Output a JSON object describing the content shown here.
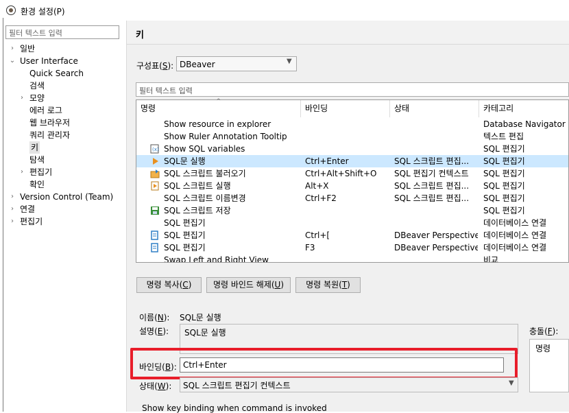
{
  "window": {
    "title": "환경 설정(P)"
  },
  "left": {
    "filter_placeholder": "필터 텍스트 입력",
    "tree": [
      {
        "label": "일반",
        "indent": 0,
        "arrow": "›"
      },
      {
        "label": "User Interface",
        "indent": 0,
        "arrow": "⌄"
      },
      {
        "label": "Quick Search",
        "indent": 1,
        "arrow": ""
      },
      {
        "label": "검색",
        "indent": 1,
        "arrow": ""
      },
      {
        "label": "모양",
        "indent": 1,
        "arrow": "›"
      },
      {
        "label": "에러 로그",
        "indent": 1,
        "arrow": ""
      },
      {
        "label": "웹 브라우저",
        "indent": 1,
        "arrow": ""
      },
      {
        "label": "쿼리 관리자",
        "indent": 1,
        "arrow": ""
      },
      {
        "label": "키",
        "indent": 1,
        "arrow": "",
        "selected": true
      },
      {
        "label": "탐색",
        "indent": 1,
        "arrow": ""
      },
      {
        "label": "편집기",
        "indent": 1,
        "arrow": "›"
      },
      {
        "label": "확인",
        "indent": 1,
        "arrow": ""
      },
      {
        "label": "Version Control (Team)",
        "indent": 0,
        "arrow": "›"
      },
      {
        "label": "연결",
        "indent": 0,
        "arrow": "›"
      },
      {
        "label": "편집기",
        "indent": 0,
        "arrow": "›"
      }
    ]
  },
  "page": {
    "title": "키"
  },
  "scheme": {
    "label": "구성표",
    "mnemonic": "S",
    "value": "DBeaver"
  },
  "command_filter": {
    "placeholder": "필터 텍스트 입력"
  },
  "table": {
    "columns": [
      "명령",
      "바인딩",
      "상태",
      "카테고리"
    ],
    "rows": [
      {
        "icon": "",
        "name": "Show resource in explorer",
        "binding": "",
        "when": "",
        "category": "Database Navigator"
      },
      {
        "icon": "",
        "name": "Show Ruler Annotation Tooltip",
        "binding": "",
        "when": "",
        "category": "텍스트 편집"
      },
      {
        "icon": "variables-icon",
        "name": "Show SQL variables",
        "binding": "",
        "when": "",
        "category": "SQL 편집기"
      },
      {
        "icon": "execute-arrow-icon",
        "name": "SQL문 실행",
        "binding": "Ctrl+Enter",
        "when": "SQL 스크립트 편집...",
        "category": "SQL 편집기",
        "selected": true
      },
      {
        "icon": "load-script-icon",
        "name": "SQL 스크립트 불러오기",
        "binding": "Ctrl+Alt+Shift+O",
        "when": "SQL 편집기 컨텍스트",
        "category": "SQL 편집기"
      },
      {
        "icon": "run-script-icon",
        "name": "SQL 스크립트 실행",
        "binding": "Alt+X",
        "when": "SQL 스크립트 편집...",
        "category": "SQL 편집기"
      },
      {
        "icon": "",
        "name": "SQL 스크립트 이름변경",
        "binding": "Ctrl+F2",
        "when": "SQL 스크립트 편집...",
        "category": "SQL 편집기"
      },
      {
        "icon": "save-script-icon",
        "name": "SQL 스크립트 저장",
        "binding": "",
        "when": "",
        "category": "SQL 편집기"
      },
      {
        "icon": "",
        "name": "SQL 편집기",
        "binding": "",
        "when": "",
        "category": "데이터베이스 연결"
      },
      {
        "icon": "sql-editor-icon",
        "name": "SQL 편집기",
        "binding": "Ctrl+[",
        "when": "DBeaver Perspective",
        "category": "데이터베이스 연결"
      },
      {
        "icon": "sql-editor-icon",
        "name": "SQL 편집기",
        "binding": "F3",
        "when": "DBeaver Perspective",
        "category": "데이터베이스 연결"
      },
      {
        "icon": "",
        "name": "Swap Left and Right View",
        "binding": "",
        "when": "",
        "category": "비교"
      }
    ]
  },
  "buttons": {
    "copy": {
      "label": "명령 복사(",
      "mn": "C",
      "end": ")"
    },
    "unbind": {
      "label": "명령 바인드 해제(",
      "mn": "U",
      "end": ")"
    },
    "restore": {
      "label": "명령 복원(",
      "mn": "T",
      "end": ")"
    }
  },
  "details": {
    "name_label": "이름(",
    "name_mn": "N",
    "name_end": "):",
    "name_value": "SQL문 실행",
    "desc_label": "설명(",
    "desc_mn": "E",
    "desc_end": "):",
    "desc_value": "SQL문 실행",
    "binding_label": "바인딩(",
    "binding_mn": "B",
    "binding_end": "):",
    "binding_value": "Ctrl+Enter",
    "when_label": "상태(",
    "when_mn": "W",
    "when_end": "):",
    "when_value": "SQL 스크립트 편집기 컨텍스트",
    "conflicts_label": "충돌(",
    "conflicts_mn": "F",
    "conflicts_end": "):",
    "conflicts_header": "명령",
    "show_binding": "Show key binding when command is invoked"
  },
  "colors": {
    "highlight_border": "#e81d2a",
    "selection": "#cce8ff"
  }
}
